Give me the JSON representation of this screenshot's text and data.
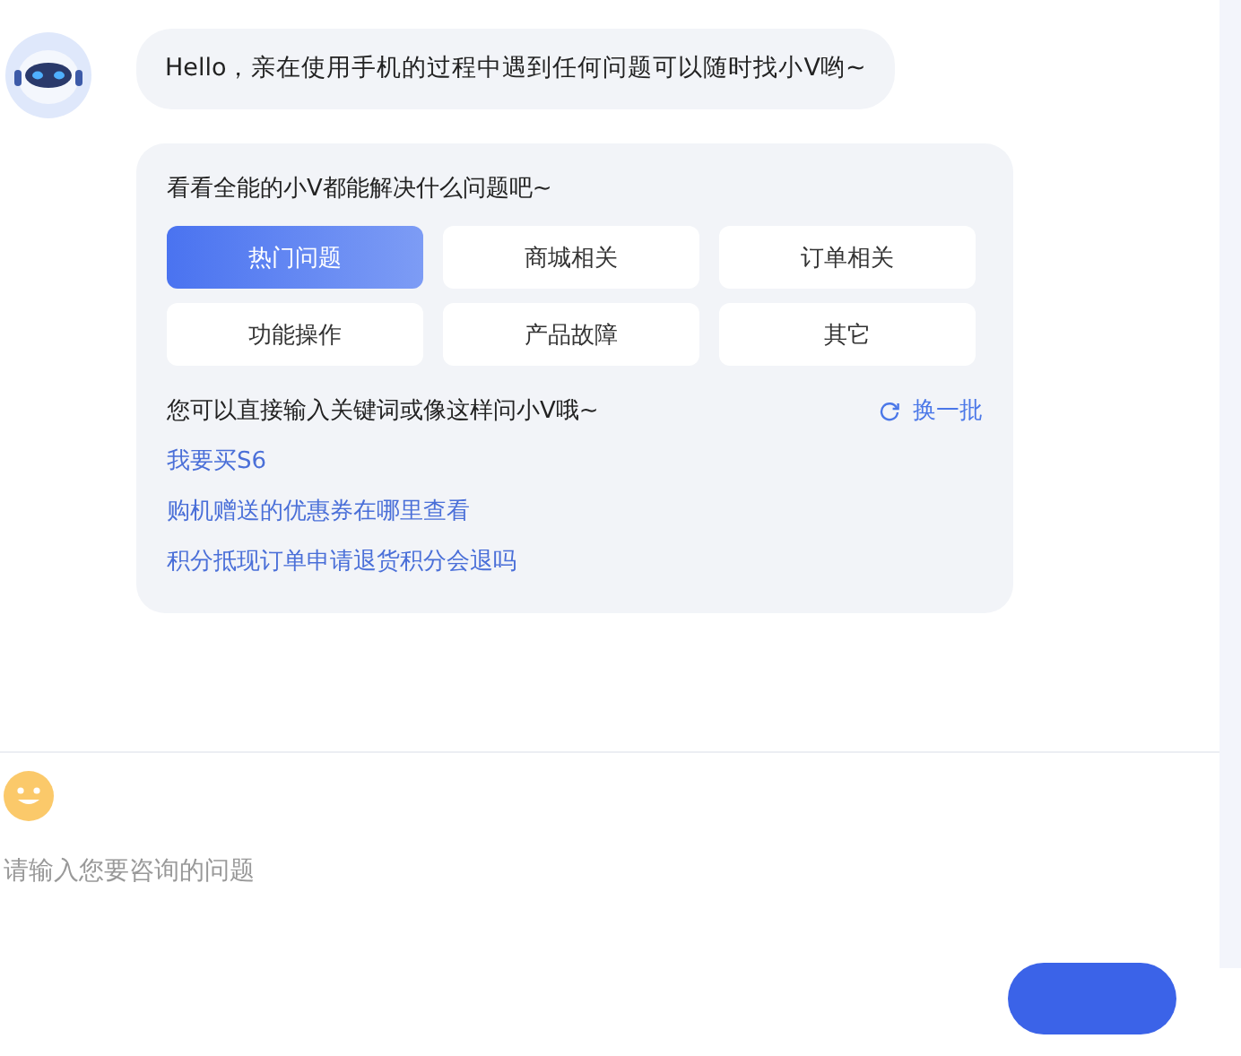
{
  "greeting": "Hello，亲在使用手机的过程中遇到任何问题可以随时找小V哟~",
  "card": {
    "title": "看看全能的小V都能解决什么问题吧~",
    "categories": [
      {
        "label": "热门问题",
        "selected": true
      },
      {
        "label": "商城相关",
        "selected": false
      },
      {
        "label": "订单相关",
        "selected": false
      },
      {
        "label": "功能操作",
        "selected": false
      },
      {
        "label": "产品故障",
        "selected": false
      },
      {
        "label": "其它",
        "selected": false
      }
    ],
    "hint": "您可以直接输入关键词或像这样问小V哦~",
    "refresh": "换一批",
    "questions": [
      "我要买S6",
      "购机赠送的优惠券在哪里查看",
      "积分抵现订单申请退货积分会退吗"
    ]
  },
  "input": {
    "placeholder": "请输入您要咨询的问题"
  }
}
